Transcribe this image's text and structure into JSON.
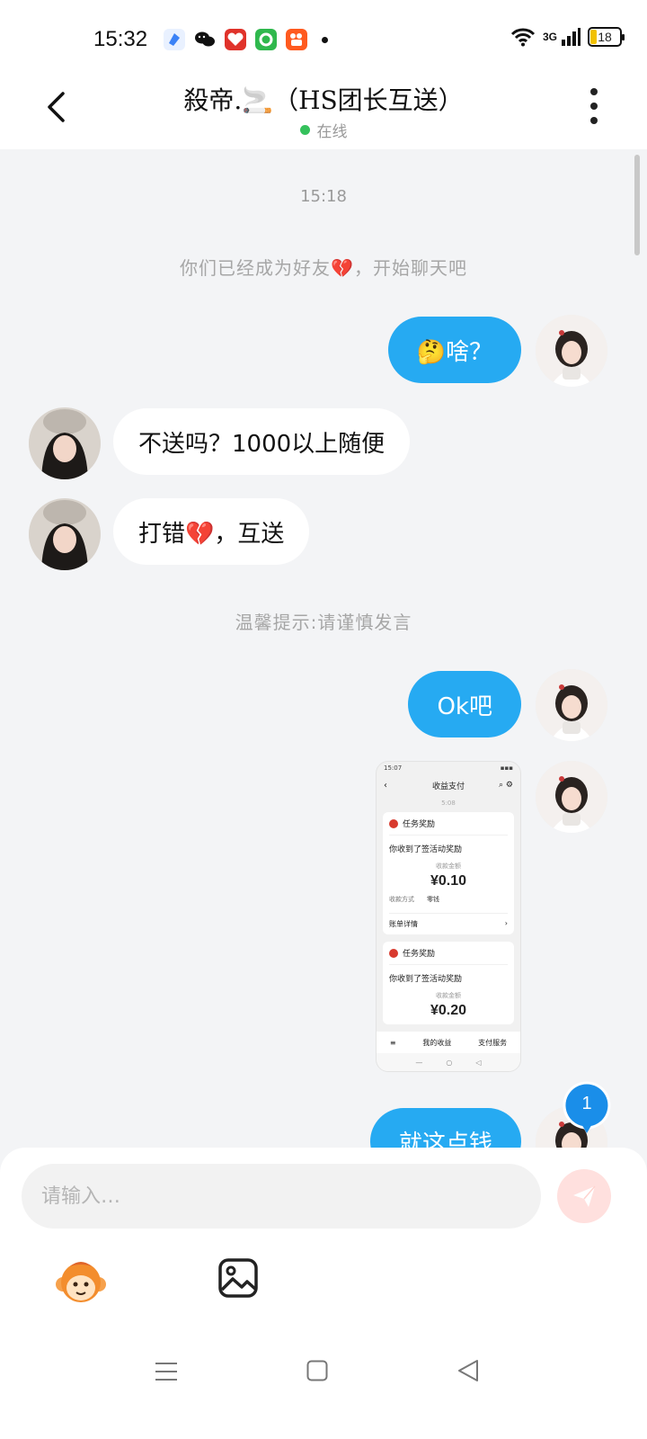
{
  "status_bar": {
    "time": "15:32",
    "network": "3G",
    "battery": "18",
    "app_icons": [
      "browser-icon",
      "wechat-icon",
      "gift-app-icon",
      "green-app-icon",
      "kuaishou-icon"
    ]
  },
  "header": {
    "title": "殺帝.🚬（HS团长互送）",
    "status": "在线"
  },
  "chat": {
    "time": "15:18",
    "system_notice": "你们已经成为好友💔，开始聊天吧",
    "tip": "温馨提示:请谨慎发言",
    "messages": [
      {
        "side": "me",
        "text": "🤔啥？"
      },
      {
        "side": "other",
        "text": "不送吗？1000以上随便"
      },
      {
        "side": "other",
        "text": "打错💔，互送"
      },
      {
        "side": "me",
        "text": "Ok吧"
      },
      {
        "side": "me",
        "text": "就这点钱"
      }
    ],
    "unread_count": "1",
    "shared_screenshot": {
      "status_time": "15:07",
      "title": "收益支付",
      "time": "5:08",
      "cards": [
        {
          "label": "任务奖励",
          "line": "你收到了签活动奖励",
          "sub": "收款金额",
          "amount": "¥0.10",
          "meta_key": "收款方式",
          "meta_val": "零钱",
          "footer": "账单详情"
        },
        {
          "label": "任务奖励",
          "line": "你收到了签活动奖励",
          "sub": "收款金额",
          "amount": "¥0.20"
        }
      ],
      "tabs": [
        "我的收益",
        "支付服务"
      ]
    }
  },
  "input": {
    "placeholder": "请输入…"
  },
  "colors": {
    "accent": "#26aaf2",
    "online": "#35c15c",
    "send_disabled": "#ffe0de"
  }
}
